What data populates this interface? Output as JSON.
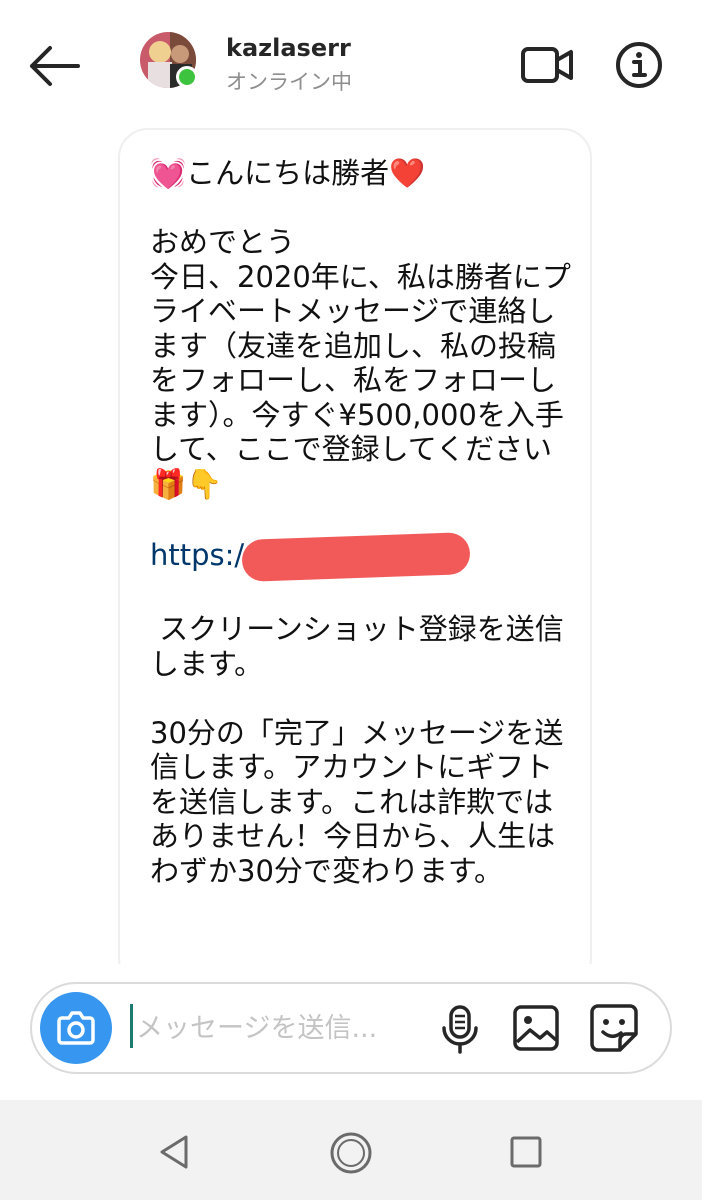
{
  "header": {
    "back_icon": "arrow-left-icon",
    "username": "kazlaserr",
    "status": "オンライン中",
    "video_icon": "video-camera-icon",
    "info_icon": "info-icon",
    "online_color": "#3ec33e"
  },
  "message": {
    "greeting": "💓こんにちは勝者❤️",
    "body1": "おめでとう\n今日、2020年に、私は勝者にプライベートメッセージで連絡します（友達を追加し、私の投稿をフォローし、私をフォローします）。今すぐ¥500,000を入手して、ここで登録してください🎁👇",
    "link": "https:/",
    "body2": " スクリーンショット登録を送信します。",
    "body3": "30分の「完了」メッセージを送信します。アカウントにギフトを送信します。これは詐欺ではありません！今日から、人生はわずか30分で変わります。",
    "redaction_color": "#f25a5a",
    "link_color": "#00376b"
  },
  "composer": {
    "placeholder": "メッセージを送信...",
    "value": "",
    "camera_icon": "camera-icon",
    "mic_icon": "microphone-icon",
    "gallery_icon": "image-icon",
    "sticker_icon": "sticker-icon",
    "accent_color": "#3797f0"
  },
  "navbar": {
    "back_icon": "nav-back-triangle-icon",
    "home_icon": "nav-home-circle-icon",
    "recent_icon": "nav-recents-square-icon"
  }
}
